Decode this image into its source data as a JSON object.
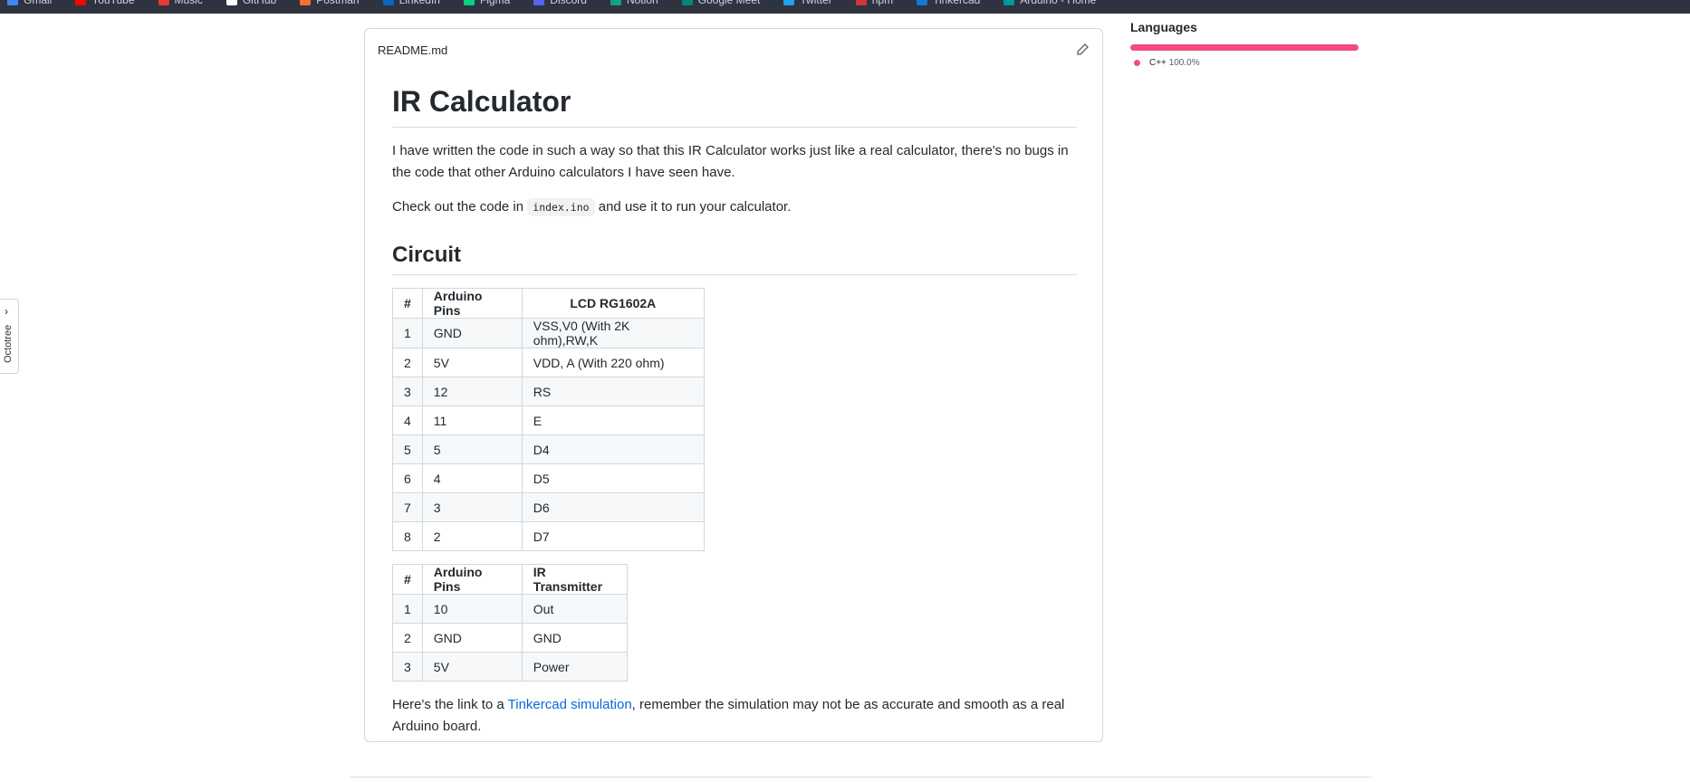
{
  "bookmarks": [
    {
      "label": "Gmail",
      "color": "#4285f4"
    },
    {
      "label": "YouTube",
      "color": "#ff0000"
    },
    {
      "label": "Music",
      "color": "#e53935"
    },
    {
      "label": "GitHub",
      "color": "#ffffff"
    },
    {
      "label": "Postman",
      "color": "#ff6c37"
    },
    {
      "label": "LinkedIn",
      "color": "#0a66c2"
    },
    {
      "label": "Figma",
      "color": "#0acf83"
    },
    {
      "label": "Discord",
      "color": "#5865f2"
    },
    {
      "label": "Notion",
      "color": "#10a37f"
    },
    {
      "label": "Google Meet",
      "color": "#00897b"
    },
    {
      "label": "Twitter",
      "color": "#1da1f2"
    },
    {
      "label": "npm",
      "color": "#cb3837"
    },
    {
      "label": "Tinkercad",
      "color": "#1477d1"
    },
    {
      "label": "Arduino - Home",
      "color": "#00979d"
    }
  ],
  "readme": {
    "filename": "README.md",
    "title": "IR Calculator",
    "intro": "I have written the code in such a way so that this IR Calculator works just like a real calculator, there's no bugs in the code that other Arduino calculators I have seen have.",
    "check_pre": "Check out the code in ",
    "check_code": "index.ino",
    "check_post": " and use it to run your calculator.",
    "circuit_heading": "Circuit",
    "table1": {
      "headers": [
        "#",
        "Arduino Pins",
        "LCD RG1602A"
      ],
      "rows": [
        [
          "1",
          "GND",
          "VSS,V0 (With 2K ohm),RW,K"
        ],
        [
          "2",
          "5V",
          "VDD, A (With 220 ohm)"
        ],
        [
          "3",
          "12",
          "RS"
        ],
        [
          "4",
          "11",
          "E"
        ],
        [
          "5",
          "5",
          "D4"
        ],
        [
          "6",
          "4",
          "D5"
        ],
        [
          "7",
          "3",
          "D6"
        ],
        [
          "8",
          "2",
          "D7"
        ]
      ]
    },
    "table2": {
      "headers": [
        "#",
        "Arduino Pins",
        "IR Transmitter"
      ],
      "rows": [
        [
          "1",
          "10",
          "Out"
        ],
        [
          "2",
          "GND",
          "GND"
        ],
        [
          "3",
          "5V",
          "Power"
        ]
      ]
    },
    "link_pre": "Here's the link to a ",
    "link_text": "Tinkercad simulation",
    "link_post": ", remember the simulation may not be as accurate and smooth as a real Arduino board."
  },
  "languages": {
    "heading": "Languages",
    "items": [
      {
        "name": "C++",
        "percent": "100.0%",
        "value": 100,
        "color": "#f34b7d"
      }
    ]
  },
  "octotree": {
    "label": "Octotree"
  }
}
